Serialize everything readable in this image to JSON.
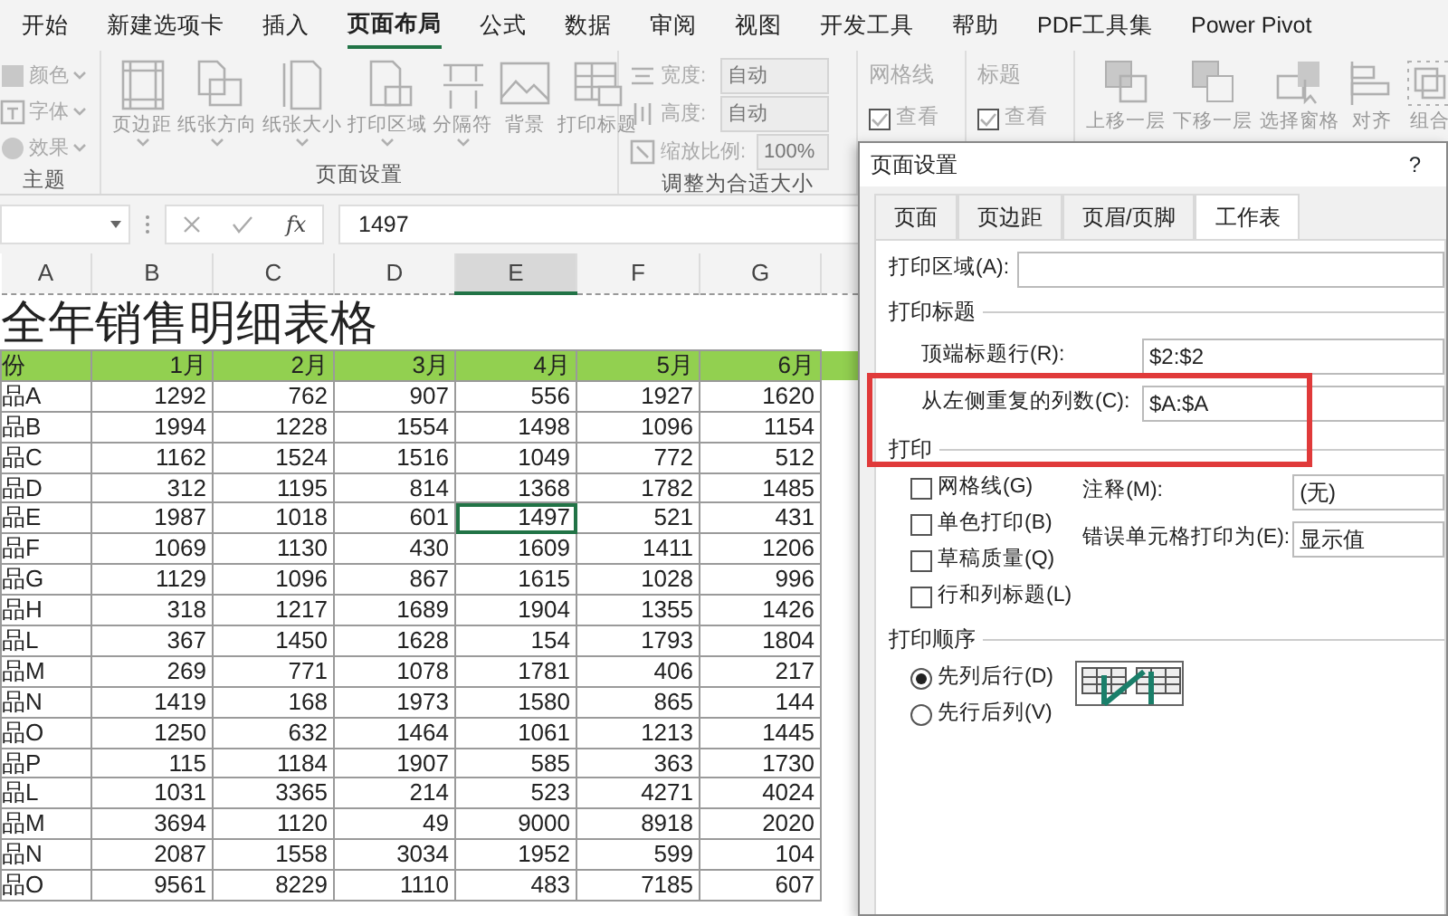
{
  "ribbon_tabs": [
    {
      "label": "开始",
      "selected": false
    },
    {
      "label": "新建选项卡",
      "selected": false
    },
    {
      "label": "插入",
      "selected": false
    },
    {
      "label": "页面布局",
      "selected": true
    },
    {
      "label": "公式",
      "selected": false
    },
    {
      "label": "数据",
      "selected": false
    },
    {
      "label": "审阅",
      "selected": false
    },
    {
      "label": "视图",
      "selected": false
    },
    {
      "label": "开发工具",
      "selected": false
    },
    {
      "label": "帮助",
      "selected": false
    },
    {
      "label": "PDF工具集",
      "selected": false
    },
    {
      "label": "Power Pivot",
      "selected": false
    }
  ],
  "theme_group": {
    "label": "主题",
    "items": [
      "颜色",
      "字体",
      "效果"
    ]
  },
  "page_setup_group": {
    "label": "页面设置",
    "buttons": [
      {
        "label": "页边距",
        "dropdown": true
      },
      {
        "label": "纸张方向",
        "dropdown": true
      },
      {
        "label": "纸张大小",
        "dropdown": true
      },
      {
        "label": "打印区域",
        "dropdown": true
      },
      {
        "label": "分隔符",
        "dropdown": true
      },
      {
        "label": "背景",
        "dropdown": false
      },
      {
        "label": "打印标题",
        "dropdown": false
      }
    ]
  },
  "fit_group": {
    "label": "调整为合适大小",
    "rows": [
      {
        "label": "宽度:",
        "value": "自动"
      },
      {
        "label": "高度:",
        "value": "自动"
      },
      {
        "label": "缩放比例:",
        "value": "100%"
      }
    ]
  },
  "sheet_options": [
    {
      "label": "网格线",
      "option": "查看",
      "checked": true
    },
    {
      "label": "标题",
      "option": "查看",
      "checked": true
    }
  ],
  "arrange_group": {
    "buttons": [
      "上移一层",
      "下移一层",
      "选择窗格",
      "对齐",
      "组合"
    ]
  },
  "formula_bar": {
    "function_label": "fx",
    "value": "1497"
  },
  "sheet": {
    "columns": [
      {
        "label": "A",
        "selected": false
      },
      {
        "label": "B",
        "selected": false
      },
      {
        "label": "C",
        "selected": false
      },
      {
        "label": "D",
        "selected": false
      },
      {
        "label": "E",
        "selected": true
      },
      {
        "label": "F",
        "selected": false
      },
      {
        "label": "G",
        "selected": false
      }
    ],
    "title": "全年销售明细表格",
    "header": [
      "份",
      "1月",
      "2月",
      "3月",
      "4月",
      "5月",
      "6月"
    ],
    "rows": [
      {
        "cells": [
          "品A",
          "1292",
          "762",
          "907",
          "556",
          "1927",
          "1620"
        ],
        "selected": false
      },
      {
        "cells": [
          "品B",
          "1994",
          "1228",
          "1554",
          "1498",
          "1096",
          "1154"
        ],
        "selected": false
      },
      {
        "cells": [
          "品C",
          "1162",
          "1524",
          "1516",
          "1049",
          "772",
          "512"
        ],
        "selected": false
      },
      {
        "cells": [
          "品D",
          "312",
          "1195",
          "814",
          "1368",
          "1782",
          "1485"
        ],
        "selected": false
      },
      {
        "cells": [
          "品E",
          "1987",
          "1018",
          "601",
          "1497",
          "521",
          "431"
        ],
        "selected": true
      },
      {
        "cells": [
          "品F",
          "1069",
          "1130",
          "430",
          "1609",
          "1411",
          "1206"
        ],
        "selected": false
      },
      {
        "cells": [
          "品G",
          "1129",
          "1096",
          "867",
          "1615",
          "1028",
          "996"
        ],
        "selected": false
      },
      {
        "cells": [
          "品H",
          "318",
          "1217",
          "1689",
          "1904",
          "1355",
          "1426"
        ],
        "selected": false
      },
      {
        "cells": [
          "品L",
          "367",
          "1450",
          "1628",
          "154",
          "1793",
          "1804"
        ],
        "selected": false
      },
      {
        "cells": [
          "品M",
          "269",
          "771",
          "1078",
          "1781",
          "406",
          "217"
        ],
        "selected": false
      },
      {
        "cells": [
          "品N",
          "1419",
          "168",
          "1973",
          "1580",
          "865",
          "144"
        ],
        "selected": false
      },
      {
        "cells": [
          "品O",
          "1250",
          "632",
          "1464",
          "1061",
          "1213",
          "1445"
        ],
        "selected": false
      },
      {
        "cells": [
          "品P",
          "115",
          "1184",
          "1907",
          "585",
          "363",
          "1730"
        ],
        "selected": false
      },
      {
        "cells": [
          "品L",
          "1031",
          "3365",
          "214",
          "523",
          "4271",
          "4024"
        ],
        "selected": false
      },
      {
        "cells": [
          "品M",
          "3694",
          "1120",
          "49",
          "9000",
          "8918",
          "2020"
        ],
        "selected": false
      },
      {
        "cells": [
          "品N",
          "2087",
          "1558",
          "3034",
          "1952",
          "599",
          "104"
        ],
        "selected": false
      },
      {
        "cells": [
          "品O",
          "9561",
          "8229",
          "1110",
          "483",
          "7185",
          "607"
        ],
        "selected": false
      }
    ]
  },
  "dialog": {
    "title": "页面设置",
    "help": "?",
    "tabs": [
      {
        "label": "页面",
        "selected": false
      },
      {
        "label": "页边距",
        "selected": false
      },
      {
        "label": "页眉/页脚",
        "selected": false
      },
      {
        "label": "工作表",
        "selected": true
      }
    ],
    "print_area": {
      "label": "打印区域(A):"
    },
    "print_titles": {
      "label": "打印标题",
      "fields": [
        {
          "label": "顶端标题行(R):",
          "value": "$2:$2",
          "highlighted": false
        },
        {
          "label": "从左侧重复的列数(C):",
          "value": "$A:$A",
          "highlighted": true
        }
      ]
    },
    "print": {
      "label": "打印",
      "checkboxes": [
        {
          "label": "网格线(G)",
          "checked": false
        },
        {
          "label": "单色打印(B)",
          "checked": false
        },
        {
          "label": "草稿质量(Q)",
          "checked": false
        },
        {
          "label": "行和列标题(L)",
          "checked": false
        }
      ],
      "selects": [
        {
          "label": "注释(M):",
          "value": "(无)"
        },
        {
          "label": "错误单元格打印为(E):",
          "value": "显示值"
        }
      ]
    },
    "page_order": {
      "label": "打印顺序",
      "options": [
        {
          "label": "先列后行(D)",
          "selected": true
        },
        {
          "label": "先行后列(V)",
          "selected": false
        }
      ]
    }
  }
}
